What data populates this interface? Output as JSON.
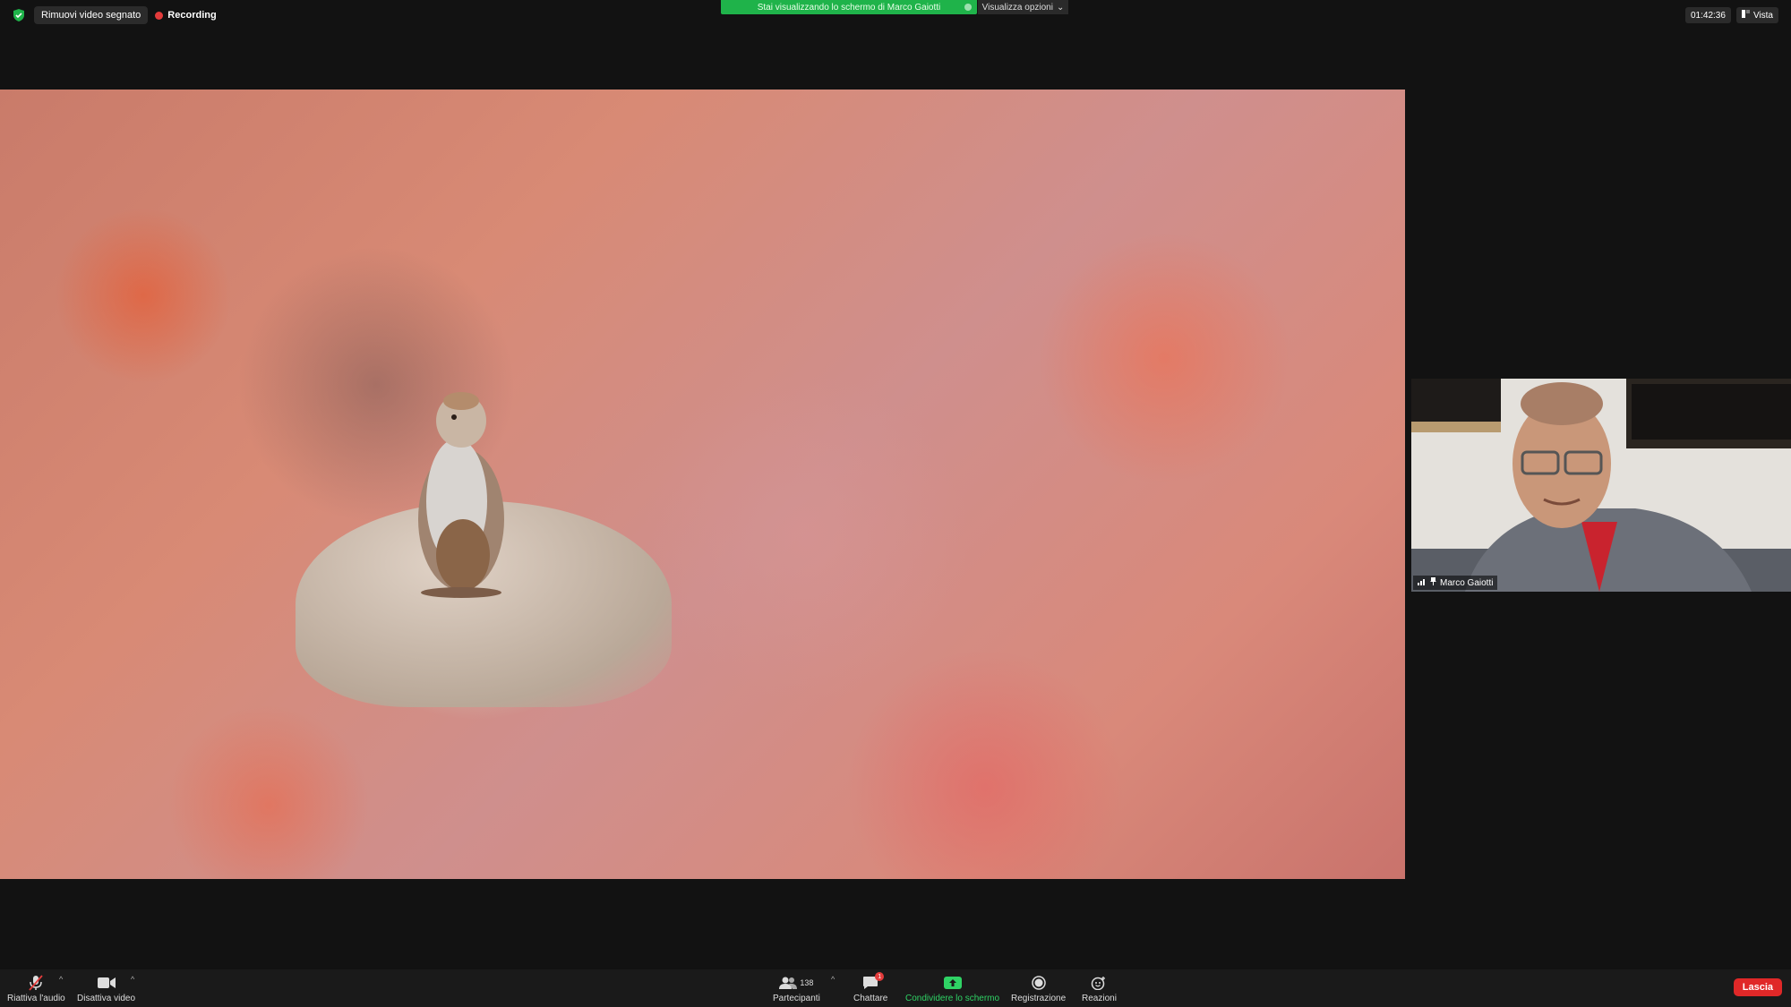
{
  "top_bar": {
    "remove_video_label": "Rimuovi video segnato",
    "recording_label": "Recording",
    "share_banner_text": "Stai visualizzando lo schermo di Marco Gaiotti",
    "view_options_label": "Visualizza opzioni",
    "clock": "01:42:36",
    "view_label": "Vista"
  },
  "participant_tile": {
    "name": "Marco Gaiotti"
  },
  "toolbar": {
    "audio_label": "Riattiva l'audio",
    "video_label": "Disattiva video",
    "participants_label": "Partecipanti",
    "participants_count": "138",
    "chat_label": "Chattare",
    "chat_badge": "1",
    "share_label": "Condividere lo schermo",
    "record_label": "Registrazione",
    "reactions_label": "Reazioni",
    "leave_label": "Lascia"
  },
  "colors": {
    "share_green": "#1fb34a",
    "recording_red": "#e33b3b",
    "leave_red": "#e02828"
  },
  "icons": [
    "shield-icon",
    "recording-dot-icon",
    "chevron-down-icon",
    "view-icon",
    "muted-mic-icon",
    "video-camera-icon",
    "participants-icon",
    "chat-icon",
    "share-screen-icon",
    "record-icon",
    "reactions-icon",
    "signal-icon",
    "pin-icon"
  ]
}
